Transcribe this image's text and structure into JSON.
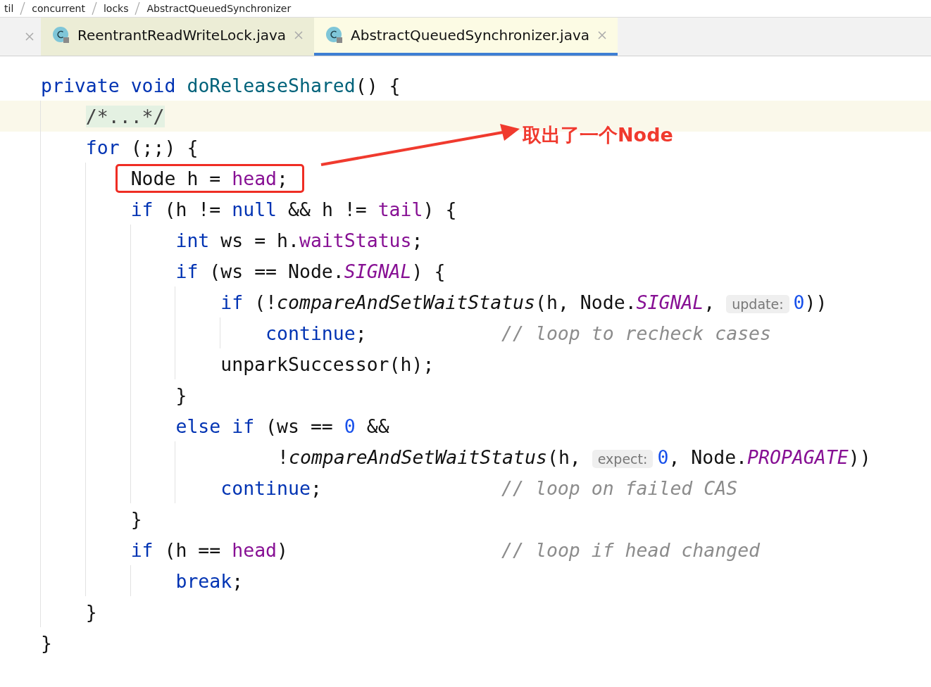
{
  "breadcrumbs": [
    "til",
    "concurrent",
    "locks",
    "AbstractQueuedSynchronizer"
  ],
  "tabs": [
    {
      "label": "ReentrantReadWriteLock.java",
      "selected": false
    },
    {
      "label": "AbstractQueuedSynchronizer.java",
      "selected": true
    }
  ],
  "code_lines": [
    {
      "kind": "statement",
      "tokens": [
        {
          "kind": "kw",
          "text": "private void "
        },
        {
          "kind": "fn",
          "text": "doReleaseShared"
        },
        {
          "kind": "plain",
          "text": "() {"
        }
      ],
      "children": [
        {
          "kind": "statement",
          "current": true,
          "tokens": [
            {
              "kind": "folded",
              "text": "/*...*/"
            }
          ]
        },
        {
          "kind": "statement",
          "tokens": [
            {
              "kind": "kw",
              "text": "for"
            },
            {
              "kind": "plain",
              "text": " (;;) {"
            }
          ],
          "children": [
            {
              "kind": "statement",
              "boxed": true,
              "tokens": [
                {
                  "kind": "plain",
                  "text": "Node h = "
                },
                {
                  "kind": "field",
                  "text": "head"
                },
                {
                  "kind": "plain",
                  "text": ";"
                }
              ]
            },
            {
              "kind": "statement",
              "tokens": [
                {
                  "kind": "kw",
                  "text": "if"
                },
                {
                  "kind": "plain",
                  "text": " (h != "
                },
                {
                  "kind": "kw",
                  "text": "null"
                },
                {
                  "kind": "plain",
                  "text": " && h != "
                },
                {
                  "kind": "field",
                  "text": "tail"
                },
                {
                  "kind": "plain",
                  "text": ") {"
                }
              ],
              "children": [
                {
                  "kind": "statement",
                  "tokens": [
                    {
                      "kind": "kw",
                      "text": "int"
                    },
                    {
                      "kind": "plain",
                      "text": " ws = h."
                    },
                    {
                      "kind": "field",
                      "text": "waitStatus"
                    },
                    {
                      "kind": "plain",
                      "text": ";"
                    }
                  ]
                },
                {
                  "kind": "statement",
                  "tokens": [
                    {
                      "kind": "kw",
                      "text": "if"
                    },
                    {
                      "kind": "plain",
                      "text": " (ws == Node."
                    },
                    {
                      "kind": "static",
                      "text": "SIGNAL"
                    },
                    {
                      "kind": "plain",
                      "text": ") {"
                    }
                  ],
                  "children": [
                    {
                      "kind": "statement",
                      "tokens": [
                        {
                          "kind": "kw",
                          "text": "if"
                        },
                        {
                          "kind": "plain",
                          "text": " (!"
                        },
                        {
                          "kind": "call",
                          "text": "compareAndSetWaitStatus"
                        },
                        {
                          "kind": "plain",
                          "text": "(h, Node."
                        },
                        {
                          "kind": "static",
                          "text": "SIGNAL"
                        },
                        {
                          "kind": "plain",
                          "text": ", "
                        },
                        {
                          "kind": "hint",
                          "text": "update:"
                        },
                        {
                          "kind": "num",
                          "text": "0"
                        },
                        {
                          "kind": "plain",
                          "text": "))"
                        }
                      ],
                      "children": [
                        {
                          "kind": "statement",
                          "tokens": [
                            {
                              "kind": "kw",
                              "text": "continue"
                            },
                            {
                              "kind": "plain",
                              "text": ";"
                            }
                          ],
                          "comment": "// loop to recheck cases"
                        }
                      ]
                    },
                    {
                      "kind": "statement",
                      "tokens": [
                        {
                          "kind": "plain",
                          "text": "unparkSuccessor(h);"
                        }
                      ]
                    }
                  ]
                },
                {
                  "kind": "statement",
                  "tokens": [
                    {
                      "kind": "plain",
                      "text": "}"
                    }
                  ]
                },
                {
                  "kind": "statement",
                  "tokens": [
                    {
                      "kind": "kw",
                      "text": "else if"
                    },
                    {
                      "kind": "plain",
                      "text": " (ws == "
                    },
                    {
                      "kind": "num",
                      "text": "0"
                    },
                    {
                      "kind": "plain",
                      "text": " &&"
                    }
                  ],
                  "children": [
                    {
                      "kind": "continuation",
                      "tokens": [
                        {
                          "kind": "plain",
                          "text": "!"
                        },
                        {
                          "kind": "call",
                          "text": "compareAndSetWaitStatus"
                        },
                        {
                          "kind": "plain",
                          "text": "(h, "
                        },
                        {
                          "kind": "hint",
                          "text": "expect:"
                        },
                        {
                          "kind": "num",
                          "text": "0"
                        },
                        {
                          "kind": "plain",
                          "text": ", Node."
                        },
                        {
                          "kind": "static",
                          "text": "PROPAGATE"
                        },
                        {
                          "kind": "plain",
                          "text": "))"
                        }
                      ]
                    },
                    {
                      "kind": "statement",
                      "tokens": [
                        {
                          "kind": "kw",
                          "text": "continue"
                        },
                        {
                          "kind": "plain",
                          "text": ";"
                        }
                      ],
                      "comment": "// loop on failed CAS"
                    }
                  ]
                }
              ]
            },
            {
              "kind": "statement",
              "tokens": [
                {
                  "kind": "plain",
                  "text": "}"
                }
              ]
            },
            {
              "kind": "statement",
              "tokens": [
                {
                  "kind": "kw",
                  "text": "if"
                },
                {
                  "kind": "plain",
                  "text": " (h == "
                },
                {
                  "kind": "field",
                  "text": "head"
                },
                {
                  "kind": "plain",
                  "text": ")"
                }
              ],
              "comment": "// loop if head changed",
              "children": [
                {
                  "kind": "statement",
                  "tokens": [
                    {
                      "kind": "kw",
                      "text": "break"
                    },
                    {
                      "kind": "plain",
                      "text": ";"
                    }
                  ]
                }
              ]
            }
          ]
        },
        {
          "kind": "statement",
          "tokens": [
            {
              "kind": "plain",
              "text": "}"
            }
          ]
        }
      ]
    },
    {
      "kind": "statement",
      "tokens": [
        {
          "kind": "plain",
          "text": "}"
        }
      ]
    }
  ],
  "annotation": {
    "text": "取出了一个Node"
  }
}
